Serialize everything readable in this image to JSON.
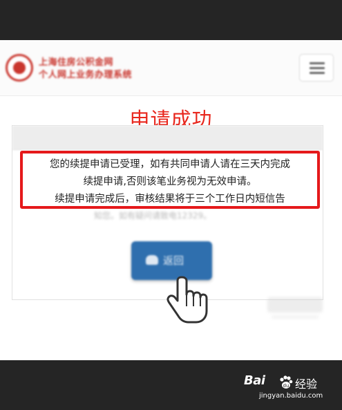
{
  "header": {
    "logo_line1": "上海住房公积金网",
    "logo_line2": "个人网上业务办理系统"
  },
  "title": "申请成功",
  "notice": {
    "line1": "您的续提申请已受理，如有共同申请人请在三天内完成",
    "line2": "续提申请,否则该笔业务视为无效申请。",
    "line3": "续提申请完成后，审核结果将于三个工作日内短信告"
  },
  "card_faded_text": "知您。如有疑问请致电12329。",
  "return_button": {
    "label": "返回",
    "icon": "home-icon"
  },
  "watermark": {
    "bai": "Bai",
    "jingyan": "经验",
    "url": "jingyan.baidu.com"
  },
  "colors": {
    "title_red": "#e8261c",
    "notice_border": "#e5191b",
    "button_blue": "#2f6fae",
    "logo_red": "#c9362e",
    "frame_dark": "#252525"
  }
}
